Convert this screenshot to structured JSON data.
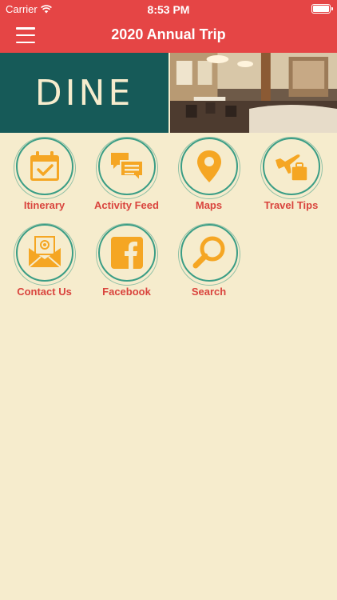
{
  "status_bar": {
    "carrier": "Carrier",
    "time": "8:53 PM"
  },
  "nav": {
    "title": "2020 Annual Trip",
    "menu_icon": "hamburger-menu-icon"
  },
  "banner": {
    "logo_text": "DINE"
  },
  "tiles": [
    {
      "label": "Itinerary",
      "icon": "calendar-check-icon"
    },
    {
      "label": "Activity Feed",
      "icon": "chat-bubbles-icon"
    },
    {
      "label": "Maps",
      "icon": "map-pin-icon"
    },
    {
      "label": "Travel Tips",
      "icon": "plane-suitcase-icon"
    },
    {
      "label": "Contact Us",
      "icon": "email-icon"
    },
    {
      "label": "Facebook",
      "icon": "facebook-icon"
    },
    {
      "label": "Search",
      "icon": "magnifier-icon"
    }
  ],
  "colors": {
    "accent": "#e54545",
    "background": "#f6eccd",
    "icon": "#f5a623",
    "ring": "#3a9d85",
    "label": "#d9443d",
    "banner": "#165a58"
  }
}
